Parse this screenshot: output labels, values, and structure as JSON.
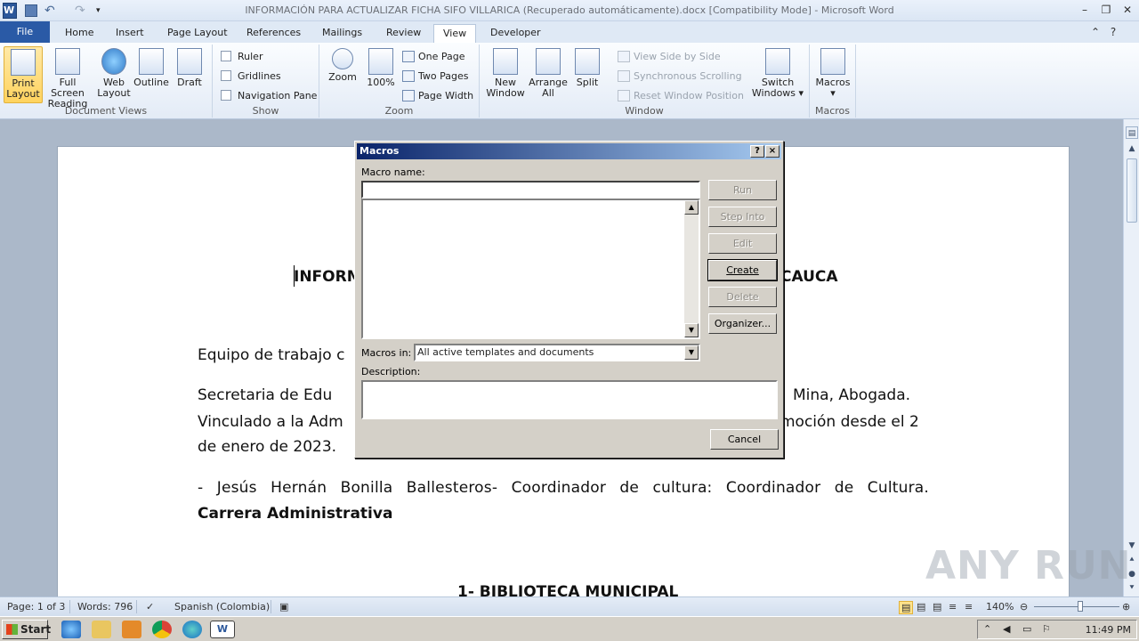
{
  "window": {
    "title": "INFORMACIÓN PARA ACTUALIZAR FICHA SIFO VILLARICA (Recuperado automáticamente).docx [Compatibility Mode]  -  Microsoft Word",
    "app_icon": "W"
  },
  "tabs": [
    "File",
    "Home",
    "Insert",
    "Page Layout",
    "References",
    "Mailings",
    "Review",
    "View",
    "Developer"
  ],
  "ribbon": {
    "document_views": {
      "label": "Document Views",
      "print_layout": "Print Layout",
      "full_screen_reading_1": "Full Screen",
      "full_screen_reading_2": "Reading",
      "web_layout_1": "Web",
      "web_layout_2": "Layout",
      "outline": "Outline",
      "draft": "Draft"
    },
    "show": {
      "label": "Show",
      "ruler": "Ruler",
      "gridlines": "Gridlines",
      "navigation_pane": "Navigation Pane"
    },
    "zoom": {
      "label": "Zoom",
      "zoom": "Zoom",
      "hundred": "100%",
      "one_page": "One Page",
      "two_pages": "Two Pages",
      "page_width": "Page Width"
    },
    "window": {
      "label": "Window",
      "new_window_1": "New",
      "new_window_2": "Window",
      "arrange_all_1": "Arrange",
      "arrange_all_2": "All",
      "split": "Split",
      "view_side_by_side": "View Side by Side",
      "synchronous_scrolling": "Synchronous Scrolling",
      "reset_window_position": "Reset Window Position",
      "switch_windows_1": "Switch",
      "switch_windows_2": "Windows"
    },
    "macros": {
      "label": "Macros",
      "macros": "Macros"
    }
  },
  "document": {
    "heading_left": "INFORM",
    "heading_right": "CAUCA",
    "lines": [
      "Equipo de trabajo c",
      "Secretaria de Edu",
      "Mina, Abogada.",
      "Vinculado a la Adm",
      "moción desde el 2",
      "de enero de 2023.",
      "- Jesús Hernán Bonilla Ballesteros- Coordinador de cultura: Coordinador de Cultura.",
      "Carrera Administrativa",
      "1- BIBLIOTECA MUNICIPAL"
    ]
  },
  "dialog": {
    "title": "Macros",
    "help": "?",
    "close": "×",
    "macro_name_label": "Macro name:",
    "macro_name_value": "",
    "macros_in_label": "Macros in:",
    "macros_in_value": "All active templates and documents",
    "description_label": "Description:",
    "buttons": {
      "run": "Run",
      "step_into": "Step Into",
      "edit": "Edit",
      "create": "Create",
      "delete": "Delete",
      "organizer": "Organizer...",
      "cancel": "Cancel"
    }
  },
  "statusbar": {
    "page": "Page: 1 of 3",
    "words": "Words: 796",
    "language": "Spanish (Colombia)",
    "zoom": "140%"
  },
  "taskbar": {
    "start": "Start",
    "clock": "11:49 PM"
  },
  "watermark": "ANY RUN"
}
